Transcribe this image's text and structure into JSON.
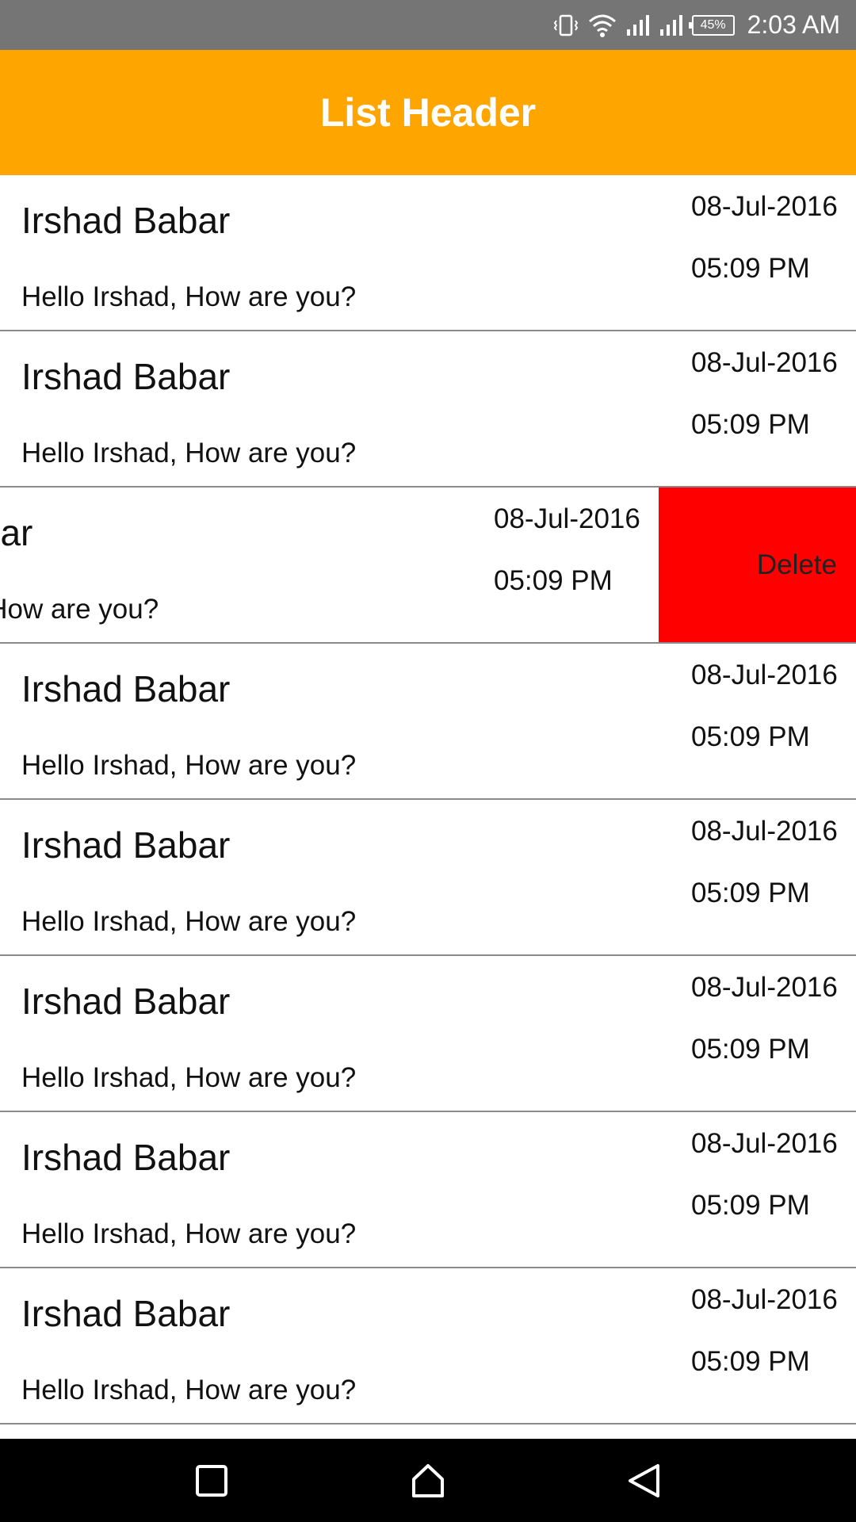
{
  "status_bar": {
    "battery": "45%",
    "time": "2:03 AM",
    "icons": [
      "vibrate-icon",
      "wifi-icon",
      "signal-icon",
      "signal-icon",
      "battery-icon"
    ]
  },
  "header": {
    "title": "List Header",
    "color": "#ffa500"
  },
  "list": {
    "items": [
      {
        "name": "Irshad Babar",
        "message": "Hello Irshad, How are you?",
        "date": "08-Jul-2016",
        "time": "05:09 PM"
      },
      {
        "name": "Irshad Babar",
        "message": "Hello Irshad, How are you?",
        "date": "08-Jul-2016",
        "time": "05:09 PM"
      },
      {
        "name": "Irshad Babar",
        "message": "Hello Irshad, How are you?",
        "date": "08-Jul-2016",
        "time": "05:09 PM",
        "swiped": true,
        "action_label": "Delete"
      },
      {
        "name": "Irshad Babar",
        "message": "Hello Irshad, How are you?",
        "date": "08-Jul-2016",
        "time": "05:09 PM"
      },
      {
        "name": "Irshad Babar",
        "message": "Hello Irshad, How are you?",
        "date": "08-Jul-2016",
        "time": "05:09 PM"
      },
      {
        "name": "Irshad Babar",
        "message": "Hello Irshad, How are you?",
        "date": "08-Jul-2016",
        "time": "05:09 PM"
      },
      {
        "name": "Irshad Babar",
        "message": "Hello Irshad, How are you?",
        "date": "08-Jul-2016",
        "time": "05:09 PM"
      },
      {
        "name": "Irshad Babar",
        "message": "Hello Irshad, How are you?",
        "date": "08-Jul-2016",
        "time": "05:09 PM"
      }
    ]
  },
  "nav_bar": {
    "buttons": [
      "recents-icon",
      "home-icon",
      "back-icon"
    ]
  }
}
